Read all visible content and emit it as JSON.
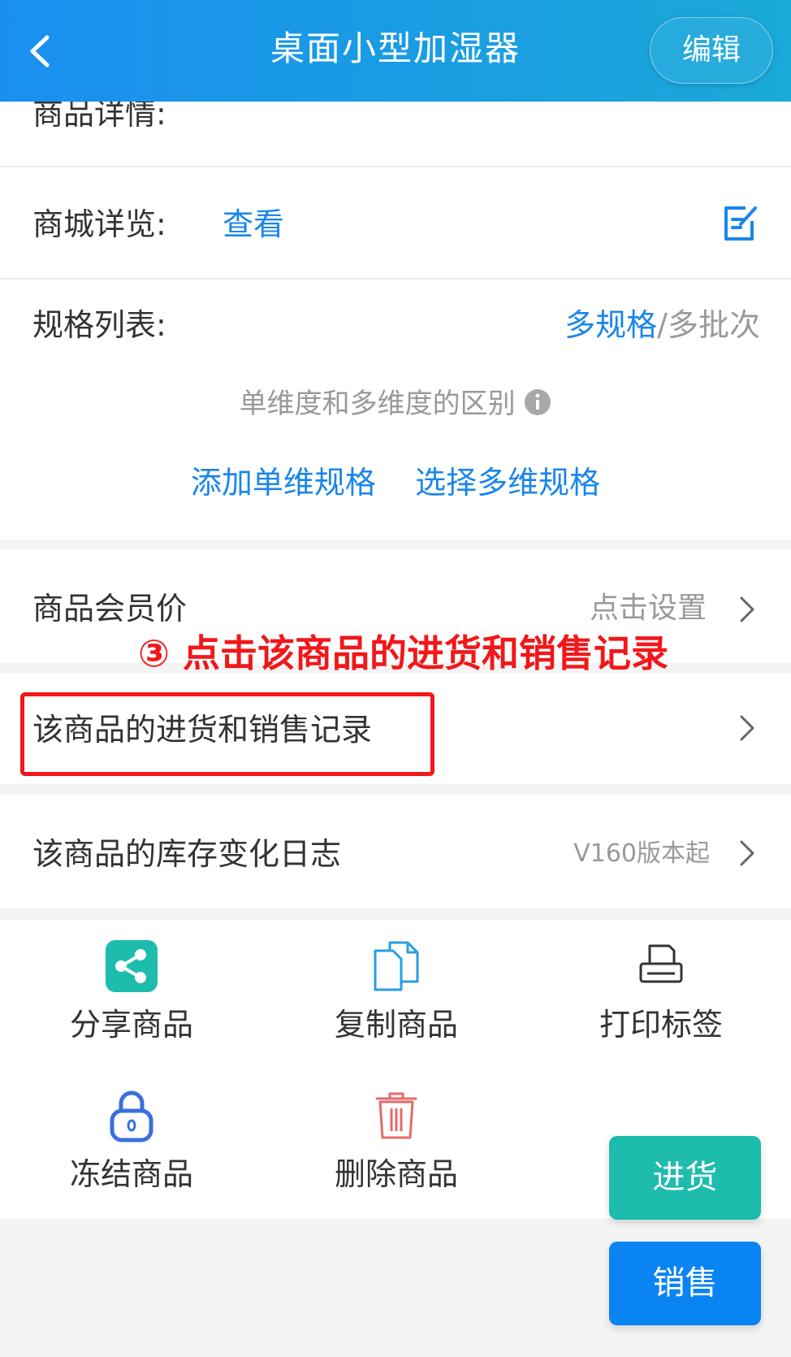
{
  "header": {
    "title": "桌面小型加湿器",
    "edit_label": "编辑"
  },
  "detail": {
    "label": "商品详情:"
  },
  "mall": {
    "label": "商城详览:",
    "link": "查看"
  },
  "spec": {
    "label": "规格列表:",
    "multi_spec": "多规格",
    "separator": "/",
    "multi_batch": "多批次",
    "hint": "单维度和多维度的区别",
    "add_single": "添加单维规格",
    "select_multi": "选择多维规格"
  },
  "rows": [
    {
      "label": "商品会员价",
      "value": "点击设置"
    },
    {
      "label": "该商品的进货和销售记录",
      "value": ""
    },
    {
      "label": "该商品的库存变化日志",
      "value": "V160版本起"
    }
  ],
  "annotation": {
    "text": "③ 点击该商品的进货和销售记录"
  },
  "actions": [
    {
      "label": "分享商品",
      "icon": "share-icon"
    },
    {
      "label": "复制商品",
      "icon": "copy-icon"
    },
    {
      "label": "打印标签",
      "icon": "printer-icon"
    },
    {
      "label": "冻结商品",
      "icon": "lock-icon"
    },
    {
      "label": "删除商品",
      "icon": "trash-icon"
    }
  ],
  "fab": {
    "purchase": "进货",
    "sale": "销售"
  },
  "colors": {
    "header_start": "#1a8ff0",
    "header_end": "#1aa9d8",
    "link": "#1a86ea",
    "purchase": "#1dbcac",
    "sale": "#0b84f3",
    "annotation": "#f1171a"
  }
}
